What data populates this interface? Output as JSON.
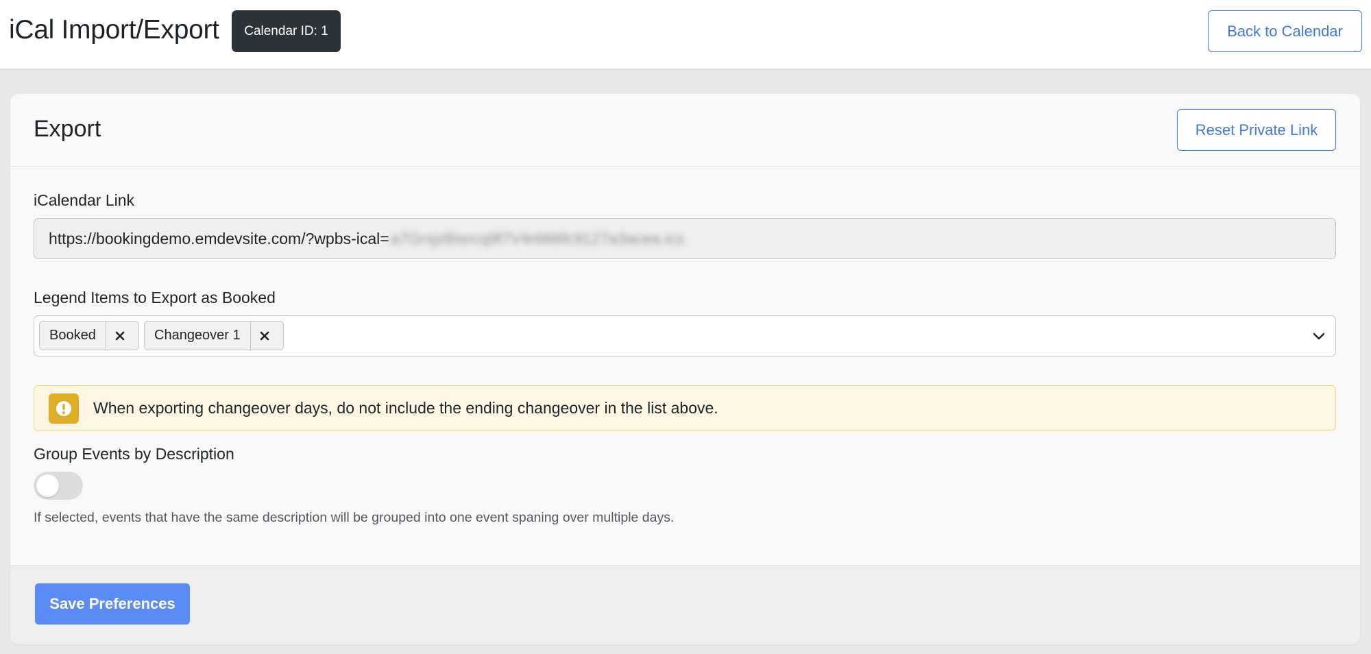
{
  "header": {
    "title": "iCal Import/Export",
    "calendar_badge": "Calendar ID: 1",
    "back_button": "Back to Calendar"
  },
  "export": {
    "title": "Export",
    "reset_button": "Reset Private Link",
    "ical_link": {
      "label": "iCalendar Link",
      "value_visible": "https://bookingdemo.emdevsite.com/?wpbs-ical=",
      "value_blurred": "a7GrsjzBisrcq9f7V4r666fc9127a3acea.ics"
    },
    "legend": {
      "label": "Legend Items to Export as Booked",
      "selected": [
        {
          "label": "Booked",
          "remove": "×"
        },
        {
          "label": "Changeover 1",
          "remove": "×"
        }
      ]
    },
    "notice": {
      "text": "When exporting changeover days, do not include the ending changeover in the list above.",
      "icon": "warning-icon",
      "color": "#ddae25"
    },
    "group_events": {
      "label": "Group Events by Description",
      "enabled": false,
      "help": "If selected, events that have the same description will be grouped into one event spaning over multiple days."
    },
    "save_button": "Save Preferences"
  },
  "colors": {
    "accent": "#3f78e0",
    "primary_button": "#5b8cf5",
    "badge_bg": "#2c3338",
    "notice_bg": "#fcf6e3"
  }
}
